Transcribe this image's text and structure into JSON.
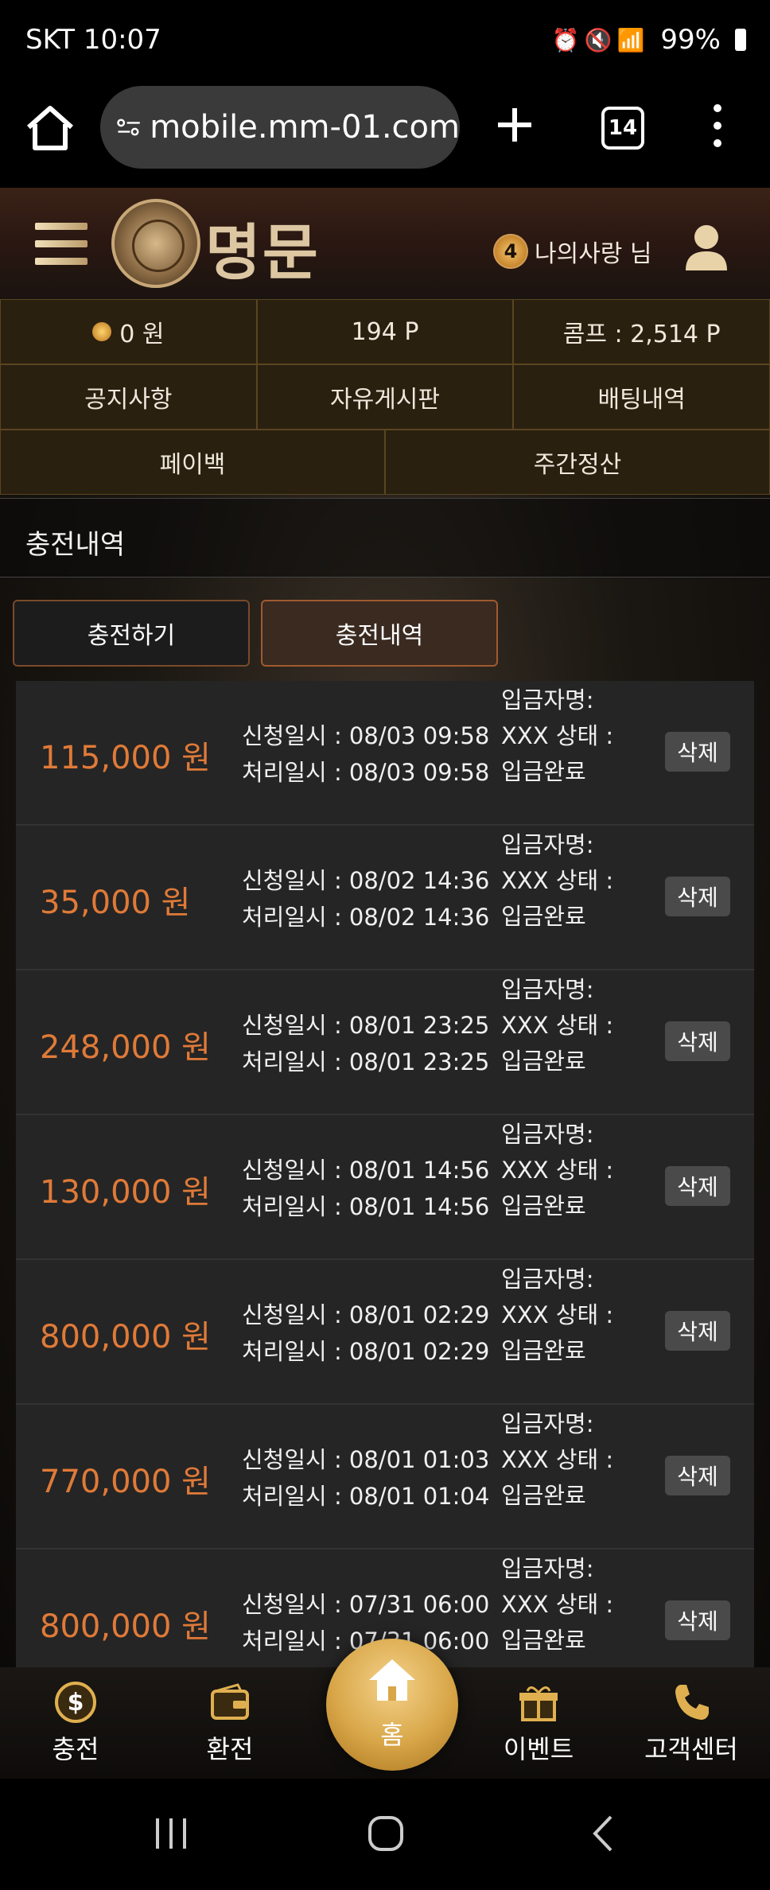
{
  "status_bar": {
    "carrier_time": "SKT 10:07",
    "battery": "99%"
  },
  "browser": {
    "url": "mobile.mm-01.com",
    "tab_count": "14"
  },
  "header": {
    "logo_text": "명문",
    "user_level": "4",
    "user_name": "나의사랑 님"
  },
  "account": {
    "balance": "0 원",
    "points": "194 P",
    "comp": "콤프 : 2,514 P"
  },
  "menu_row1": [
    "공지사항",
    "자유게시판",
    "배팅내역"
  ],
  "menu_row2": [
    "페이백",
    "주간정산"
  ],
  "section_title": "충전내역",
  "tabs": {
    "charge": "충전하기",
    "history": "충전내역"
  },
  "history_items": [
    {
      "amount": "115,000 원",
      "request": "신청일시 : 08/03 09:58",
      "processed": "처리일시 : 08/03 09:58",
      "depositor": "입금자명: XXX",
      "status": "상태 : 입금완료",
      "delete": "삭제"
    },
    {
      "amount": "35,000 원",
      "request": "신청일시 : 08/02 14:36",
      "processed": "처리일시 : 08/02 14:36",
      "depositor": "입금자명: XXX",
      "status": "상태 : 입금완료",
      "delete": "삭제"
    },
    {
      "amount": "248,000 원",
      "request": "신청일시 : 08/01 23:25",
      "processed": "처리일시 : 08/01 23:25",
      "depositor": "입금자명: XXX",
      "status": "상태 : 입금완료",
      "delete": "삭제"
    },
    {
      "amount": "130,000 원",
      "request": "신청일시 : 08/01 14:56",
      "processed": "처리일시 : 08/01 14:56",
      "depositor": "입금자명: XXX",
      "status": "상태 : 입금완료",
      "delete": "삭제"
    },
    {
      "amount": "800,000 원",
      "request": "신청일시 : 08/01 02:29",
      "processed": "처리일시 : 08/01 02:29",
      "depositor": "입금자명: XXX",
      "status": "상태 : 입금완료",
      "delete": "삭제"
    },
    {
      "amount": "770,000 원",
      "request": "신청일시 : 08/01 01:03",
      "processed": "처리일시 : 08/01 01:04",
      "depositor": "입금자명: XXX",
      "status": "상태 : 입금완료",
      "delete": "삭제"
    },
    {
      "amount": "800,000 원",
      "request": "신청일시 : 07/31 06:00",
      "processed": "처리일시 : 07/31 06:00",
      "depositor": "입금자명: XXX",
      "status": "상태 : 입금완료",
      "delete": "삭제"
    }
  ],
  "bottom_nav": {
    "charge": "충전",
    "exchange": "환전",
    "home": "홈",
    "event": "이벤트",
    "support": "고객센터"
  },
  "colors": {
    "accent": "#e07a38",
    "gold": "#d8a648",
    "cell_bg": "#2a2010"
  }
}
